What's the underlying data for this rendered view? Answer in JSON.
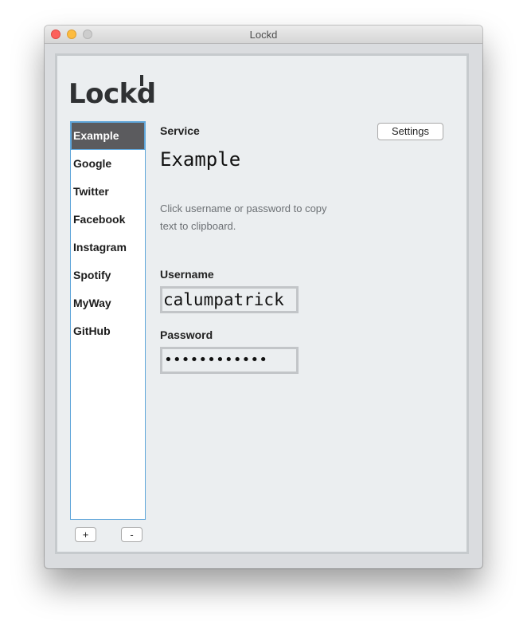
{
  "window": {
    "title": "Lockd"
  },
  "logo": {
    "text": "Lockd"
  },
  "services": [
    {
      "label": "Example",
      "selected": true
    },
    {
      "label": "Google"
    },
    {
      "label": "Twitter"
    },
    {
      "label": "Facebook"
    },
    {
      "label": "Instagram"
    },
    {
      "label": "Spotify"
    },
    {
      "label": "MyWay"
    },
    {
      "label": "GitHub"
    }
  ],
  "list_controls": {
    "add_label": "+",
    "remove_label": "-"
  },
  "detail": {
    "service_label": "Service",
    "service_name": "Example",
    "settings_label": "Settings",
    "help_text": "Click username or password to copy text to clipboard.",
    "username_label": "Username",
    "username_value": "calumpatrick",
    "password_label": "Password",
    "password_masked": "••••••••••••"
  },
  "colors": {
    "selection_bg": "#5b5b5e",
    "list_border": "#5fa6da",
    "close": "#fc605c",
    "minimize": "#fdbc40",
    "zoom": "#cdcdcd"
  }
}
